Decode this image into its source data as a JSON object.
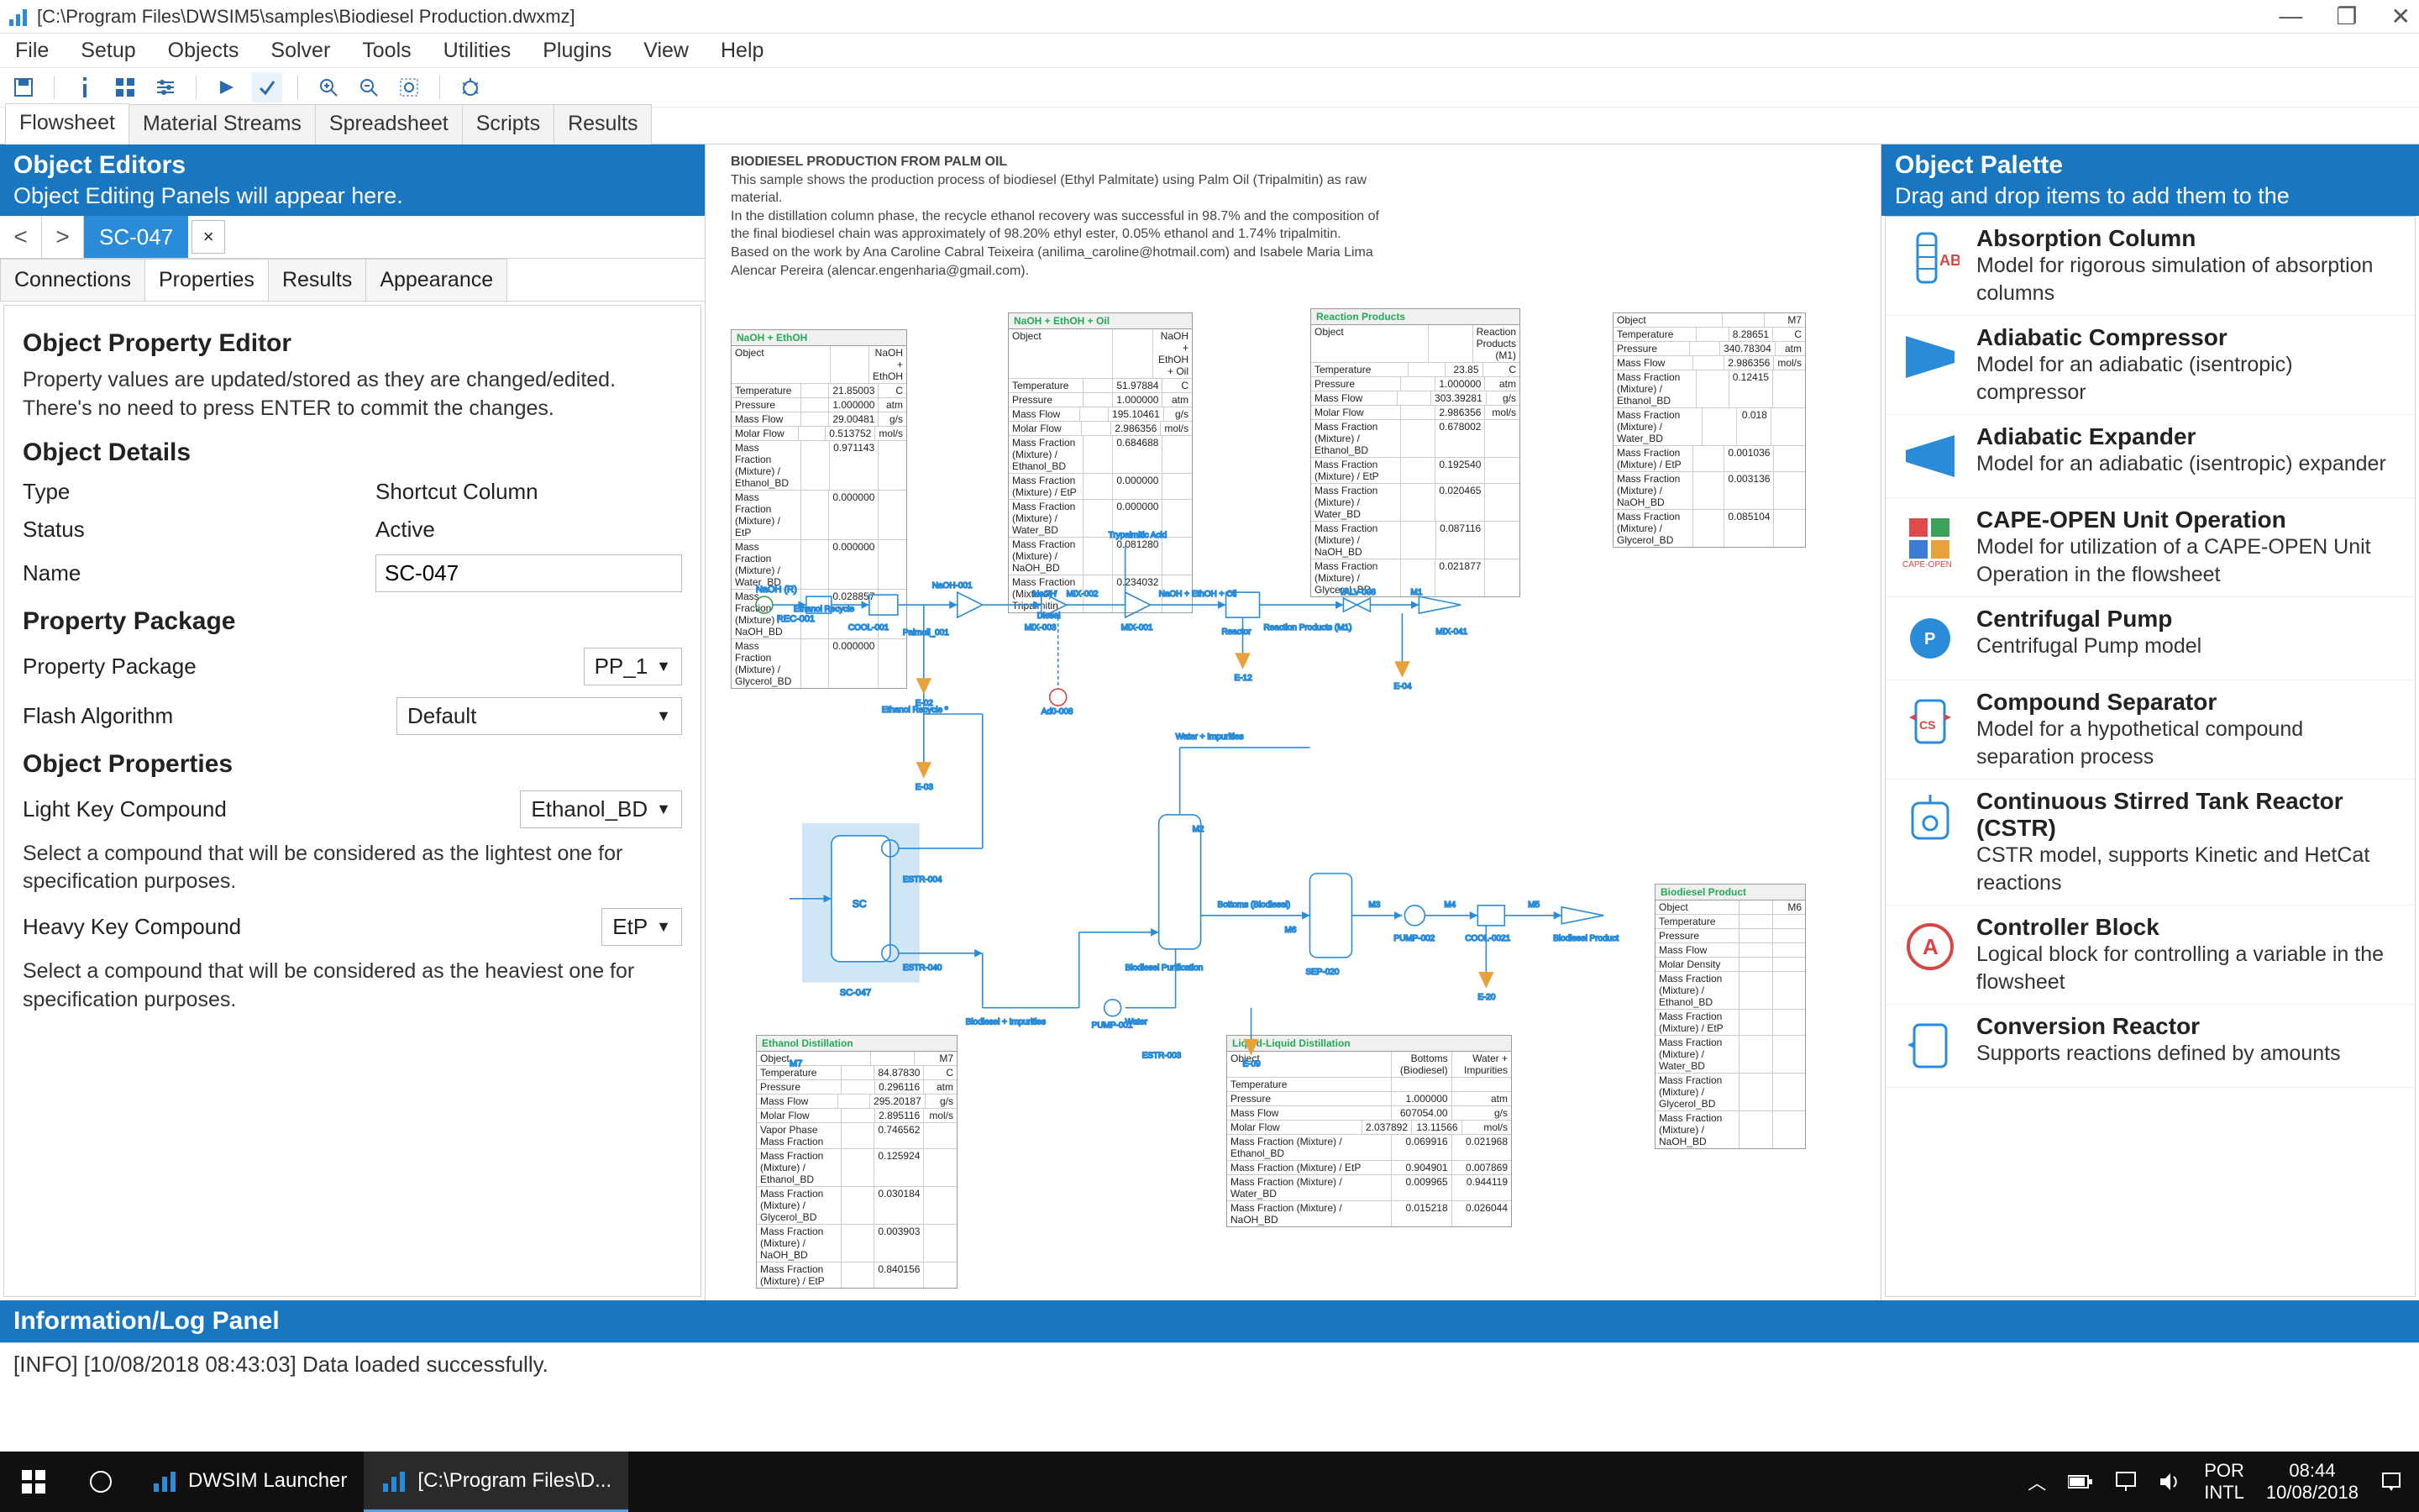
{
  "window": {
    "title": "[C:\\Program Files\\DWSIM5\\samples\\Biodiesel Production.dwxmz]"
  },
  "menu": [
    "File",
    "Setup",
    "Objects",
    "Solver",
    "Tools",
    "Utilities",
    "Plugins",
    "View",
    "Help"
  ],
  "main_tabs": [
    "Flowsheet",
    "Material Streams",
    "Spreadsheet",
    "Scripts",
    "Results"
  ],
  "active_main_tab": "Flowsheet",
  "object_editors": {
    "title": "Object Editors",
    "subtitle": "Object Editing Panels will appear here.",
    "obj_tab": "SC-047",
    "subtabs": [
      "Connections",
      "Properties",
      "Results",
      "Appearance"
    ],
    "active_subtab": "Properties",
    "editor": {
      "heading": "Object Property Editor",
      "desc": "Property values are updated/stored as they are changed/edited. There's no need to press ENTER to commit the changes.",
      "details_heading": "Object Details",
      "type_label": "Type",
      "type_value": "Shortcut Column",
      "status_label": "Status",
      "status_value": "Active",
      "name_label": "Name",
      "name_value": "SC-047",
      "pp_heading": "Property Package",
      "pp_label": "Property Package",
      "pp_value": "PP_1",
      "flash_label": "Flash Algorithm",
      "flash_value": "Default",
      "props_heading": "Object Properties",
      "lightkey_label": "Light Key Compound",
      "lightkey_value": "Ethanol_BD",
      "lightkey_desc": "Select a compound that will be considered as the lightest one for specification purposes.",
      "heavykey_label": "Heavy Key Compound",
      "heavykey_value": "EtP",
      "heavykey_desc": "Select a compound that will be considered as the heaviest one for specification purposes."
    }
  },
  "flowsheet_desc": {
    "title": "BIODIESEL PRODUCTION FROM PALM OIL",
    "l1": "This sample shows the production process of biodiesel (Ethyl Palmitate) using Palm Oil (Tripalmitin) as raw material.",
    "l2": "In the distillation column phase, the recycle ethanol recovery was successful in 98.7% and the composition of",
    "l3": "the final biodiesel chain was approximately of 98.20% ethyl ester, 0.05% ethanol and 1.74% tripalmitin.",
    "l4": "Based on the work by Ana Caroline Cabral Teixeira (anilima_caroline@hotmail.com) and Isabele Maria Lima Alencar Pereira (alencar.engenharia@gmail.com)."
  },
  "flowsheet_labels": {
    "naoh_in": "NaOH (R)",
    "rec": "REC-001",
    "ethanol_recycle": "Ethanol Recycle",
    "cool001": "COOL-001",
    "palmoil_001": "Palmoil_001",
    "naoh_001": "NaOH-001",
    "mix003": "MIX-003",
    "mix002": "MIX-002",
    "naoh": "NaOH",
    "diesel": "Diesel",
    "e02": "E-02",
    "e03": "E-03",
    "ad0008": "Ad0-008",
    "trypalmitic_acid": "Trypalmitic Acid",
    "mix001": "MIX-001",
    "naoh_ethoh_oil": "NaOH + EthOH + Oil",
    "reactor": "Reactor",
    "reaction_products_m1": "Reaction Products (M1)",
    "valv008": "VALV-008",
    "m1": "M1",
    "e12": "E-12",
    "e04": "E-04",
    "ethanol_recycle2": "Ethanol Recycle *",
    "estr004": "ESTR-004",
    "sc": "SC",
    "sc047": "SC-047",
    "estr040": "ESTR-040",
    "water_impurities": "Water + Impurities",
    "m2": "M2",
    "biodiesel_purification": "Biodiesel Purification",
    "bottoms_biodiesel": "Bottoms (Biodiesel)",
    "m6": "M6",
    "sep020": "SEP-020",
    "biodiesel_impurities": "Biodiesel + Impurities",
    "water": "Water",
    "pump001": "PUMP-001",
    "pump002": "PUMP-002",
    "m3": "M3",
    "m4": "M4",
    "mix041": "MIX-041",
    "m5": "M5",
    "biodiesel_product": "Biodiesel Product",
    "cool0021": "COOL-0021",
    "e20": "E-20",
    "e09": "E-09",
    "estr003": "ESTR-003",
    "m7": "M7"
  },
  "table_naoh_ethoh": {
    "title": "NaOH + EthOH",
    "rows": [
      [
        "Object",
        "",
        "NaOH + EthOH"
      ],
      [
        "Temperature",
        "",
        "21.85003",
        "C"
      ],
      [
        "Pressure",
        "",
        "1.000000",
        "atm"
      ],
      [
        "Mass Flow",
        "",
        "29.00481",
        "g/s"
      ],
      [
        "Molar Flow",
        "",
        "0.513752",
        "mol/s"
      ],
      [
        "Mass Fraction (Mixture) / Ethanol_BD",
        "",
        "0.971143",
        ""
      ],
      [
        "Mass Fraction (Mixture) / EtP",
        "",
        "0.000000",
        ""
      ],
      [
        "Mass Fraction (Mixture) / Water_BD",
        "",
        "0.000000",
        ""
      ],
      [
        "Mass Fraction (Mixture) / NaOH_BD",
        "",
        "0.028857",
        ""
      ],
      [
        "Mass Fraction (Mixture) / Glycerol_BD",
        "",
        "0.000000",
        ""
      ]
    ]
  },
  "table_naoh_oil": {
    "title": "NaOH + EthOH + Oil",
    "rows": [
      [
        "Object",
        "",
        "NaOH + EthOH + Oil"
      ],
      [
        "Temperature",
        "",
        "51.97884",
        "C"
      ],
      [
        "Pressure",
        "",
        "1.000000",
        "atm"
      ],
      [
        "Mass Flow",
        "",
        "195.10461",
        "g/s"
      ],
      [
        "Molar Flow",
        "",
        "2.986356",
        "mol/s"
      ],
      [
        "Mass Fraction (Mixture) / Ethanol_BD",
        "",
        "0.684688",
        ""
      ],
      [
        "Mass Fraction (Mixture) / EtP",
        "",
        "0.000000",
        ""
      ],
      [
        "Mass Fraction (Mixture) / Water_BD",
        "",
        "0.000000",
        ""
      ],
      [
        "Mass Fraction (Mixture) / NaOH_BD",
        "",
        "0.081280",
        ""
      ],
      [
        "Mass Fraction (Mixture) / Tripalmitin",
        "",
        "0.234032",
        ""
      ]
    ]
  },
  "table_reaction": {
    "title": "Reaction Products",
    "rows": [
      [
        "Object",
        "",
        "Reaction Products (M1)"
      ],
      [
        "Temperature",
        "",
        "23.85",
        "C"
      ],
      [
        "Pressure",
        "",
        "1.000000",
        "atm"
      ],
      [
        "Mass Flow",
        "",
        "303.39281",
        "g/s"
      ],
      [
        "Molar Flow",
        "",
        "2.986356",
        "mol/s"
      ],
      [
        "Mass Fraction (Mixture) / Ethanol_BD",
        "",
        "0.678002",
        ""
      ],
      [
        "Mass Fraction (Mixture) / EtP",
        "",
        "0.192540",
        ""
      ],
      [
        "Mass Fraction (Mixture) / Water_BD",
        "",
        "0.020465",
        ""
      ],
      [
        "Mass Fraction (Mixture) / NaOH_BD",
        "",
        "0.087116",
        ""
      ],
      [
        "Mass Fraction (Mixture) / Glycerol_BD",
        "",
        "0.021877",
        ""
      ]
    ]
  },
  "table_m7": {
    "title": "M7",
    "rows": [
      [
        "Object",
        "",
        "M7"
      ],
      [
        "Temperature",
        "",
        "8.28651",
        "C"
      ],
      [
        "Pressure",
        "",
        "340.78304",
        "atm"
      ],
      [
        "Mass Flow",
        "",
        "2.986356",
        "mol/s"
      ],
      [
        "Mass Fraction (Mixture) / Ethanol_BD",
        "",
        "0.12415",
        ""
      ],
      [
        "Mass Fraction (Mixture) / Water_BD",
        "",
        "0.018",
        ""
      ],
      [
        "Mass Fraction (Mixture) / EtP",
        "",
        "0.001036",
        ""
      ],
      [
        "Mass Fraction (Mixture) / NaOH_BD",
        "",
        "0.003136",
        ""
      ],
      [
        "Mass Fraction (Mixture) / Glycerol_BD",
        "",
        "0.085104",
        ""
      ]
    ]
  },
  "table_ethanol_distillation": {
    "title": "Ethanol Distillation",
    "rows": [
      [
        "Object",
        "",
        "M7"
      ],
      [
        "Temperature",
        "",
        "84.87830",
        "C"
      ],
      [
        "Pressure",
        "",
        "0.296116",
        "atm"
      ],
      [
        "Mass Flow",
        "",
        "295.20187",
        "g/s"
      ],
      [
        "Molar Flow",
        "",
        "2.895116",
        "mol/s"
      ],
      [
        "Vapor Phase Mass Fraction",
        "",
        "0.746562",
        ""
      ],
      [
        "Mass Fraction (Mixture) / Ethanol_BD",
        "",
        "0.125924",
        ""
      ],
      [
        "Mass Fraction (Mixture) / Glycerol_BD",
        "",
        "0.030184",
        ""
      ],
      [
        "Mass Fraction (Mixture) / NaOH_BD",
        "",
        "0.003903",
        ""
      ],
      [
        "Mass Fraction (Mixture) / EtP",
        "",
        "0.840156",
        ""
      ]
    ]
  },
  "table_liquid_distillation": {
    "title": "Liquid-Liquid Distillation",
    "rows": [
      [
        "Object",
        "Bottoms (Biodiesel)",
        "Water + Impurities"
      ],
      [
        "Temperature",
        "",
        ""
      ],
      [
        "Pressure",
        "1.000000",
        "atm"
      ],
      [
        "Mass Flow",
        "607054.00",
        "g/s"
      ],
      [
        "Molar Flow",
        "2.037892",
        "13.11566",
        "mol/s"
      ],
      [
        "Mass Fraction (Mixture) / Ethanol_BD",
        "0.069916",
        "0.021968"
      ],
      [
        "Mass Fraction (Mixture) / EtP",
        "0.904901",
        "0.007869"
      ],
      [
        "Mass Fraction (Mixture) / Water_BD",
        "0.009965",
        "0.944119"
      ],
      [
        "Mass Fraction (Mixture) / NaOH_BD",
        "0.015218",
        "0.026044"
      ]
    ]
  },
  "table_biodiesel_product": {
    "title": "Biodiesel Product",
    "rows": [
      [
        "Object",
        "",
        "M6"
      ],
      [
        "Temperature",
        "",
        ""
      ],
      [
        "Pressure",
        "",
        ""
      ],
      [
        "Mass Flow",
        "",
        ""
      ],
      [
        "Molar Density",
        "",
        ""
      ],
      [
        "Mass Fraction (Mixture) / Ethanol_BD",
        "",
        ""
      ],
      [
        "Mass Fraction (Mixture) / EtP",
        "",
        ""
      ],
      [
        "Mass Fraction (Mixture) / Water_BD",
        "",
        ""
      ],
      [
        "Mass Fraction (Mixture) / Glycerol_BD",
        "",
        ""
      ],
      [
        "Mass Fraction (Mixture) / NaOH_BD",
        "",
        ""
      ]
    ]
  },
  "palette": {
    "title": "Object Palette",
    "subtitle": "Drag and drop items to add them to the",
    "items": [
      {
        "name": "Absorption Column",
        "desc": "Model for rigorous simulation of absorption columns",
        "icon": "absorption-column-icon",
        "color": "#2a8cd8",
        "badge": "AB"
      },
      {
        "name": "Adiabatic Compressor",
        "desc": "Model for an adiabatic (isentropic) compressor",
        "icon": "compressor-icon",
        "color": "#2a8cd8"
      },
      {
        "name": "Adiabatic Expander",
        "desc": "Model for an adiabatic (isentropic) expander",
        "icon": "expander-icon",
        "color": "#2a8cd8"
      },
      {
        "name": "CAPE-OPEN Unit Operation",
        "desc": "Model for utilization of a CAPE-OPEN Unit Operation in the flowsheet",
        "icon": "cape-open-icon",
        "color": "#e98f2e",
        "badge": "CAPE-OPEN"
      },
      {
        "name": "Centrifugal Pump",
        "desc": "Centrifugal Pump model",
        "icon": "pump-icon",
        "color": "#2a8cd8",
        "badge": "P"
      },
      {
        "name": "Compound Separator",
        "desc": "Model for a hypothetical compound separation process",
        "icon": "compound-separator-icon",
        "color": "#2a8cd8",
        "badge": "CS"
      },
      {
        "name": "Continuous Stirred Tank Reactor (CSTR)",
        "desc": "CSTR model, supports Kinetic and HetCat reactions",
        "icon": "cstr-icon",
        "color": "#2a8cd8"
      },
      {
        "name": "Controller Block",
        "desc": "Logical block for controlling a variable in the flowsheet",
        "icon": "controller-icon",
        "color": "#d94545",
        "badge": "A"
      },
      {
        "name": "Conversion Reactor",
        "desc": "Supports reactions defined by amounts",
        "icon": "conversion-reactor-icon",
        "color": "#2a8cd8"
      }
    ]
  },
  "log": {
    "title": "Information/Log Panel",
    "line": "[INFO] [10/08/2018 08:43:03] Data loaded successfully."
  },
  "taskbar": {
    "app1": "DWSIM Launcher",
    "app2": "[C:\\Program Files\\D...",
    "lang1": "POR",
    "lang2": "INTL",
    "time": "08:44",
    "date": "10/08/2018"
  }
}
